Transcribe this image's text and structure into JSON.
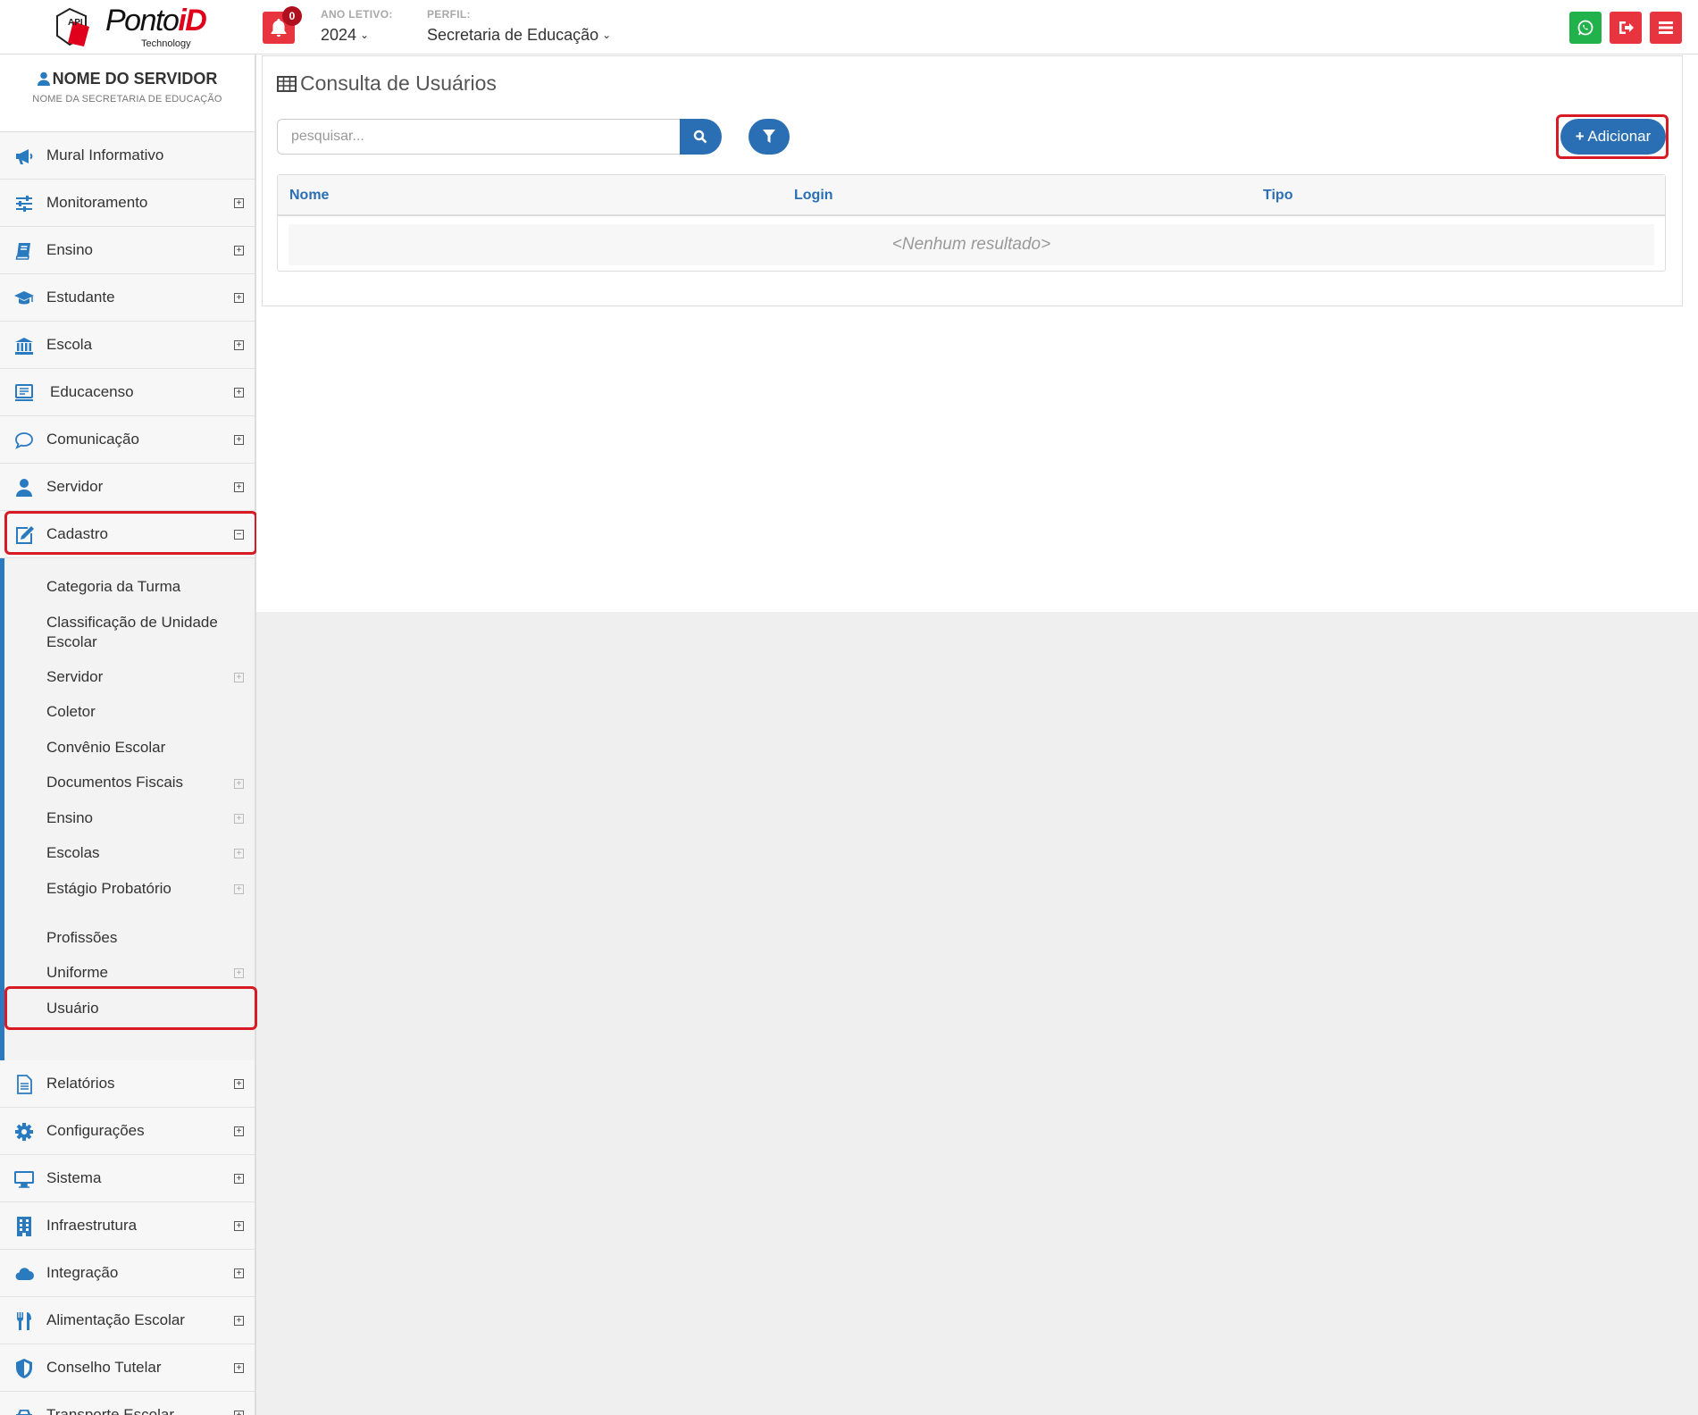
{
  "header": {
    "logo_label": "API",
    "logo_brand_prefix": "Ponto",
    "logo_brand_suffix": "iD",
    "logo_sub": "Technology",
    "notification_count": "0",
    "year_label": "ANO LETIVO:",
    "year_value": "2024",
    "profile_label": "PERFIL:",
    "profile_value": "Secretaria de Educação",
    "whatsapp_color": "#22b24c",
    "logout_color": "#e8343f",
    "menu_color": "#e8343f"
  },
  "sidebar": {
    "user_name": "NOME DO SERVIDOR",
    "user_org": "NOME DA SECRETARIA DE EDUCAÇÃO",
    "items_top": [
      {
        "label": "Mural Informativo",
        "icon": "megaphone-icon"
      },
      {
        "label": "Monitoramento",
        "icon": "sliders-icon"
      },
      {
        "label": "Ensino",
        "icon": "book-icon"
      },
      {
        "label": "Estudante",
        "icon": "graduation-cap-icon"
      },
      {
        "label": "Escola",
        "icon": "bank-icon"
      },
      {
        "label": "Educacenso",
        "icon": "monitor-list-icon"
      },
      {
        "label": "Comunicação",
        "icon": "chat-bubble-icon"
      },
      {
        "label": "Servidor",
        "icon": "user-icon"
      },
      {
        "label": "Cadastro",
        "icon": "edit-icon"
      }
    ],
    "cadastro_submenu": [
      {
        "label": "Categoria da Turma"
      },
      {
        "label": "Classificação de Unidade Escolar"
      },
      {
        "label": "Servidor"
      },
      {
        "label": "Coletor"
      },
      {
        "label": "Convênio Escolar"
      },
      {
        "label": "Documentos Fiscais"
      },
      {
        "label": "Ensino"
      },
      {
        "label": "Escolas"
      },
      {
        "label": "Estágio Probatório"
      },
      {
        "label": "Profissões"
      },
      {
        "label": "Uniforme"
      },
      {
        "label": "Usuário"
      }
    ],
    "items_bottom": [
      {
        "label": "Relatórios",
        "icon": "document-icon"
      },
      {
        "label": "Configurações",
        "icon": "gear-icon"
      },
      {
        "label": "Sistema",
        "icon": "desktop-icon"
      },
      {
        "label": "Infraestrutura",
        "icon": "building-icon"
      },
      {
        "label": "Integração",
        "icon": "cloud-icon"
      },
      {
        "label": "Alimentação Escolar",
        "icon": "cutlery-icon"
      },
      {
        "label": "Conselho Tutelar",
        "icon": "shield-icon"
      },
      {
        "label": "Transporte Escolar",
        "icon": "car-icon"
      }
    ],
    "accent_color": "#2a7abf"
  },
  "main": {
    "title": "Consulta de Usuários",
    "search_placeholder": "pesquisar...",
    "add_label": "Adicionar",
    "columns": [
      "Nome",
      "Login",
      "Tipo"
    ],
    "empty_message": "<Nenhum resultado>",
    "accent_color": "#2a6fb3",
    "highlight_color": "#d71a24"
  }
}
